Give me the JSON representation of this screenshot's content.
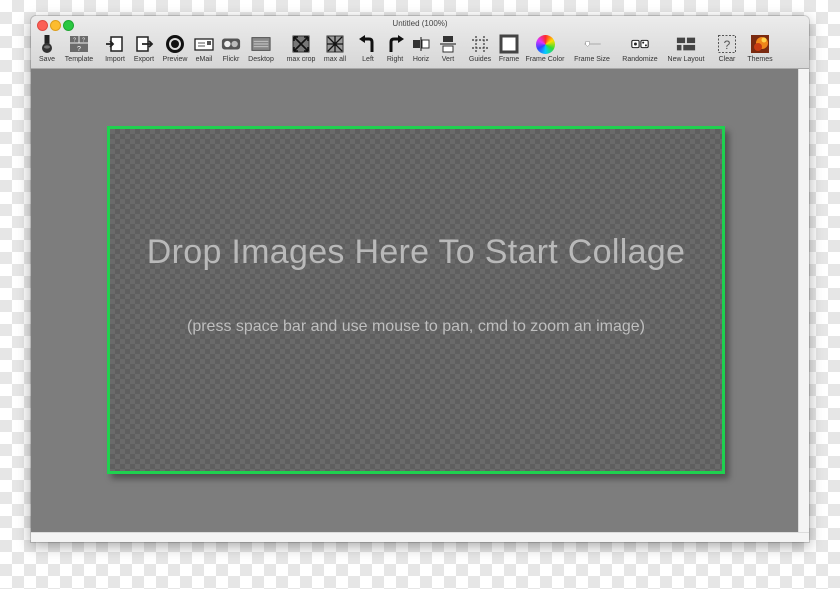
{
  "window": {
    "title": "Untitled (100%)"
  },
  "toolbar": {
    "items": [
      {
        "label": "Save",
        "icon": "save-icon"
      },
      {
        "label": "Template",
        "icon": "template-icon"
      },
      {
        "label": "Import",
        "icon": "import-icon"
      },
      {
        "label": "Export",
        "icon": "export-icon"
      },
      {
        "label": "Preview",
        "icon": "preview-icon"
      },
      {
        "label": "eMail",
        "icon": "email-icon"
      },
      {
        "label": "Flickr",
        "icon": "flickr-icon"
      },
      {
        "label": "Desktop",
        "icon": "desktop-icon"
      },
      {
        "label": "max crop",
        "icon": "max-crop-icon"
      },
      {
        "label": "max all",
        "icon": "max-all-icon"
      },
      {
        "label": "Left",
        "icon": "rotate-left-icon"
      },
      {
        "label": "Right",
        "icon": "rotate-right-icon"
      },
      {
        "label": "Horiz",
        "icon": "flip-horizontal-icon"
      },
      {
        "label": "Vert",
        "icon": "flip-vertical-icon"
      },
      {
        "label": "Guides",
        "icon": "guides-icon"
      },
      {
        "label": "Frame",
        "icon": "frame-icon"
      },
      {
        "label": "Frame Color",
        "icon": "color-wheel-icon"
      },
      {
        "label": "Frame Size",
        "icon": "frame-size-slider-icon"
      },
      {
        "label": "Randomize",
        "icon": "randomize-icon"
      },
      {
        "label": "New Layout",
        "icon": "new-layout-icon"
      },
      {
        "label": "Clear",
        "icon": "clear-icon"
      },
      {
        "label": "Themes",
        "icon": "themes-icon"
      }
    ]
  },
  "canvas": {
    "drop_title": "Drop Images Here To Start Collage",
    "drop_hint": "(press space bar and use mouse to pan, cmd to zoom an image)",
    "frame_color": "#1fd14f",
    "background_color": "#7d7d7d"
  }
}
